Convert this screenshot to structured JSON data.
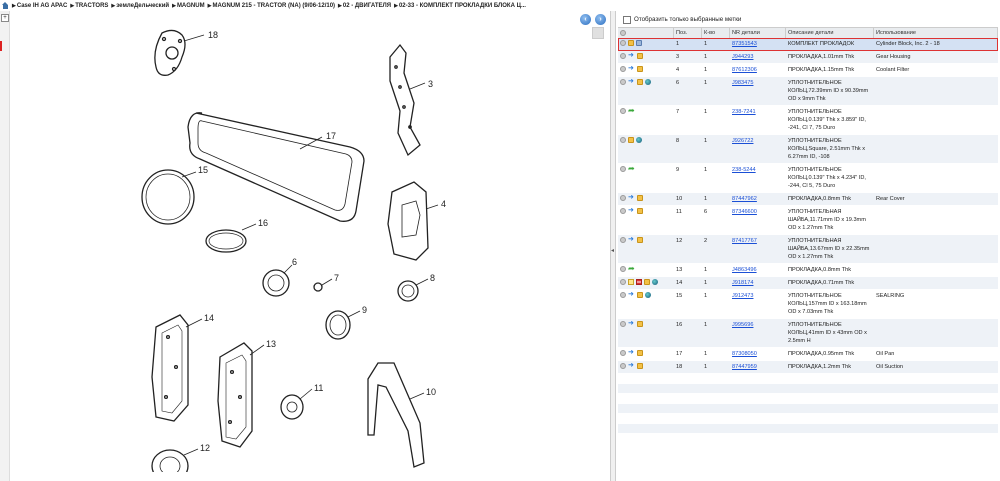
{
  "breadcrumb": [
    "Case IH AG APAC",
    "TRACTORS",
    "землеДельческий",
    "MAGNUM",
    "MAGNUM 215 - TRACTOR (NA) (9/06-12/10)",
    "02 - ДВИГАТЕЛЯ",
    "02-33 - КОМПЛЕКТ ПРОКЛАДКИ БЛОКА Ц..."
  ],
  "filter": {
    "label": "Отобразить только выбранные метки"
  },
  "columns": {
    "pos": "Поз.",
    "qty": "К-во",
    "nr": "NR детали",
    "desc": "Описание детали",
    "use": "Использование"
  },
  "diagram": {
    "callouts": [
      "18",
      "3",
      "17",
      "15",
      "4",
      "16",
      "6",
      "7",
      "8",
      "9",
      "14",
      "13",
      "11",
      "10",
      "12"
    ]
  },
  "rows": [
    {
      "pos": "1",
      "qty": "1",
      "nr": "87351543",
      "desc": "КОМПЛЕКТ ПРОКЛАДОК",
      "use": "Cylinder Block, Inc. 2 - 18",
      "icons": [
        "info",
        "box",
        "lock"
      ],
      "selected": true
    },
    {
      "pos": "3",
      "qty": "1",
      "nr": "J944293",
      "desc": "ПРОКЛАДКА,1.01mm Thk",
      "use": "Gear Housing",
      "icons": [
        "info",
        "arrow",
        "box"
      ]
    },
    {
      "pos": "4",
      "qty": "1",
      "nr": "87612306",
      "desc": "ПРОКЛАДКА,1.15mm Thk",
      "use": "Coolant Filter",
      "icons": [
        "info",
        "arrow",
        "box"
      ]
    },
    {
      "pos": "6",
      "qty": "1",
      "nr": "J983475",
      "desc": "УПЛОТНИТЕЛЬНОЕ КОЛЬЦ,72.39mm ID x 90.39mm OD x 9mm Thk",
      "use": "",
      "icons": [
        "info",
        "arrow",
        "box",
        "globe"
      ]
    },
    {
      "pos": "7",
      "qty": "1",
      "nr": "238-7241",
      "desc": "УПЛОТНИТЕЛЬНОЕ КОЛЬЦ,0.139\" Thk x 3.859\" ID, -241, Cl 7, 75 Duro",
      "use": "",
      "icons": [
        "info",
        "green"
      ]
    },
    {
      "pos": "8",
      "qty": "1",
      "nr": "J926722",
      "desc": "УПЛОТНИТЕЛЬНОЕ КОЛЬЦ,Square, 2.51mm Thk x 6.27mm ID, -108",
      "use": "",
      "icons": [
        "info",
        "box",
        "globe"
      ]
    },
    {
      "pos": "9",
      "qty": "1",
      "nr": "238-5244",
      "desc": "УПЛОТНИТЕЛЬНОЕ КОЛЬЦ,0.139\" Thk x 4.234\" ID, -244, Cl 5, 75 Duro",
      "use": "",
      "icons": [
        "info",
        "green"
      ]
    },
    {
      "pos": "10",
      "qty": "1",
      "nr": "87447962",
      "desc": "ПРОКЛАДКА,0.8mm Thk",
      "use": "Rear Cover",
      "icons": [
        "info",
        "arrow",
        "box"
      ]
    },
    {
      "pos": "11",
      "qty": "6",
      "nr": "87346600",
      "desc": "УПЛОТНИТЕЛЬНАЯ ШАЙБА,11.71mm ID x 19.3mm OD x 1.27mm Thk",
      "use": "",
      "icons": [
        "info",
        "arrow",
        "box"
      ]
    },
    {
      "pos": "12",
      "qty": "2",
      "nr": "87417767",
      "desc": "УПЛОТНИТЕЛЬНАЯ ШАЙБА,13.67mm ID x 22.35mm OD x 1.27mm Thk",
      "use": "",
      "icons": [
        "info",
        "arrow",
        "box"
      ]
    },
    {
      "pos": "13",
      "qty": "1",
      "nr": "J4863496",
      "desc": "ПРОКЛАДКА,0.8mm Thk",
      "use": "",
      "icons": [
        "info",
        "green"
      ]
    },
    {
      "pos": "14",
      "qty": "1",
      "nr": "J918174",
      "desc": "ПРОКЛАДКА,0.71mm Thk",
      "use": "",
      "icons": [
        "info",
        "note",
        "list",
        "box",
        "globe"
      ]
    },
    {
      "pos": "15",
      "qty": "1",
      "nr": "J912473",
      "desc": "УПЛОТНИТЕЛЬНОЕ КОЛЬЦ,157mm ID x 163.18mm OD x 7.03mm Thk",
      "use": "SEALRING",
      "icons": [
        "info",
        "arrow",
        "box",
        "globe"
      ]
    },
    {
      "pos": "16",
      "qty": "1",
      "nr": "J995696",
      "desc": "УПЛОТНИТЕЛЬНОЕ КОЛЬЦ,41mm ID x 43mm OD x 2.5mm H",
      "use": "",
      "icons": [
        "info",
        "arrow",
        "box"
      ]
    },
    {
      "pos": "17",
      "qty": "1",
      "nr": "87308050",
      "desc": "ПРОКЛАДКА,0.95mm Thk",
      "use": "Oil Pan",
      "icons": [
        "info",
        "arrow",
        "box"
      ]
    },
    {
      "pos": "18",
      "qty": "1",
      "nr": "87447959",
      "desc": "ПРОКЛАДКА,1.2mm Thk",
      "use": "Oil Suction",
      "icons": [
        "info",
        "arrow",
        "box"
      ]
    }
  ]
}
